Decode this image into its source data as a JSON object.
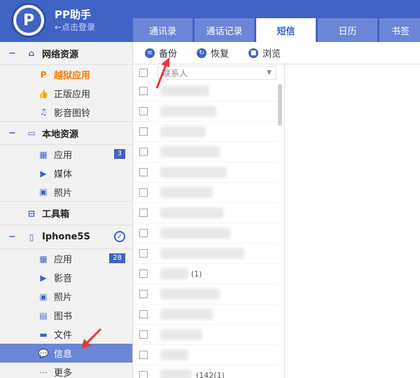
{
  "header": {
    "app_title": "PP助手",
    "login_text": "←点击登录",
    "logo_glyph": "P",
    "brand_color": "#3f63c4"
  },
  "tabs": [
    {
      "label": "通讯录"
    },
    {
      "label": "通话记录"
    },
    {
      "label": "短信",
      "active": true
    },
    {
      "label": "日历"
    },
    {
      "label": "书签"
    }
  ],
  "sidebar": {
    "network": {
      "title": "网络资源",
      "items": [
        {
          "label": "越狱应用"
        },
        {
          "label": "正版应用"
        },
        {
          "label": "影音图铃"
        }
      ]
    },
    "local": {
      "title": "本地资源",
      "items": [
        {
          "label": "应用",
          "badge": "3"
        },
        {
          "label": "媒体"
        },
        {
          "label": "照片"
        }
      ]
    },
    "toolbox": {
      "title": "工具箱"
    },
    "device": {
      "title": "Iphone5S",
      "items": [
        {
          "label": "应用",
          "badge": "28"
        },
        {
          "label": "影音"
        },
        {
          "label": "照片"
        },
        {
          "label": "图书"
        },
        {
          "label": "文件"
        },
        {
          "label": "信息",
          "selected": true
        },
        {
          "label": "更多"
        }
      ]
    }
  },
  "toolbar": {
    "backup_label": "备份",
    "restore_label": "恢复",
    "browse_label": "浏览"
  },
  "list": {
    "column_header": "联系人",
    "snippets": [
      "(1)",
      "(142(1)"
    ]
  },
  "annotation_color": "#e53935"
}
